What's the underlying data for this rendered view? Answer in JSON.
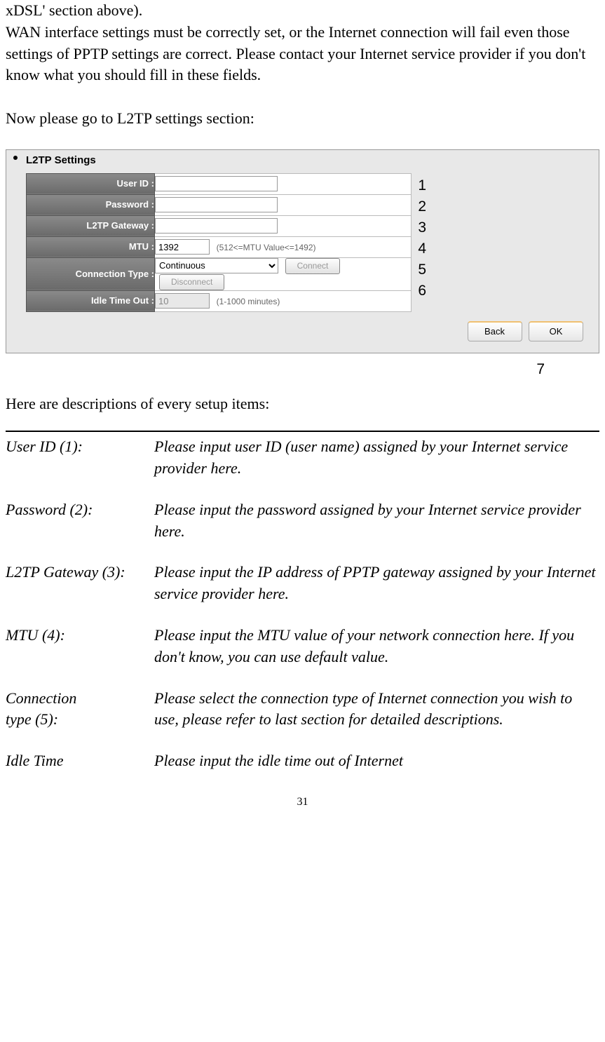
{
  "intro": {
    "p1": "xDSL' section above).",
    "p2": "WAN interface settings must be correctly set, or the Internet connection will fail even those settings of PPTP settings are correct. Please contact your Internet service provider if you don't know what you should fill in these fields.",
    "p3": "Now please go to L2TP settings section:"
  },
  "settings": {
    "title": "L2TP Settings",
    "rows": {
      "user_id": {
        "label": "User ID :",
        "value": ""
      },
      "password": {
        "label": "Password :",
        "value": ""
      },
      "gateway": {
        "label": "L2TP Gateway :",
        "value": ""
      },
      "mtu": {
        "label": "MTU :",
        "value": "1392",
        "hint": "(512<=MTU Value<=1492)"
      },
      "conn_type": {
        "label": "Connection Type :",
        "value": "Continuous",
        "connect": "Connect",
        "disconnect": "Disconnect"
      },
      "idle": {
        "label": "Idle Time Out :",
        "value": "10",
        "hint": "(1-1000 minutes)"
      }
    },
    "back": "Back",
    "ok": "OK"
  },
  "annotations": [
    "1",
    "2",
    "3",
    "4",
    "5",
    "6"
  ],
  "seven": "7",
  "desc_intro": "Here are descriptions of every setup items:",
  "descriptions": [
    {
      "term": "User ID (1):",
      "def": "Please input user ID (user name) assigned by your Internet service provider here."
    },
    {
      "term": "Password (2):",
      "def": "Please input the password assigned by your Internet service provider here."
    },
    {
      "term": "L2TP Gateway (3):",
      "def": "Please input the IP address of PPTP gateway assigned by your Internet service provider here."
    },
    {
      "term": "MTU (4):",
      "def": "Please input the MTU value of your network connection here. If you don't know, you can use default value."
    },
    {
      "term_a": "Connection",
      "term_b": "type (5):",
      "def": "Please select the connection type of Internet connection you wish to use, please refer to last section for detailed descriptions."
    },
    {
      "term": "Idle Time",
      "def": "Please input the idle time out of Internet"
    }
  ],
  "page_number": "31"
}
